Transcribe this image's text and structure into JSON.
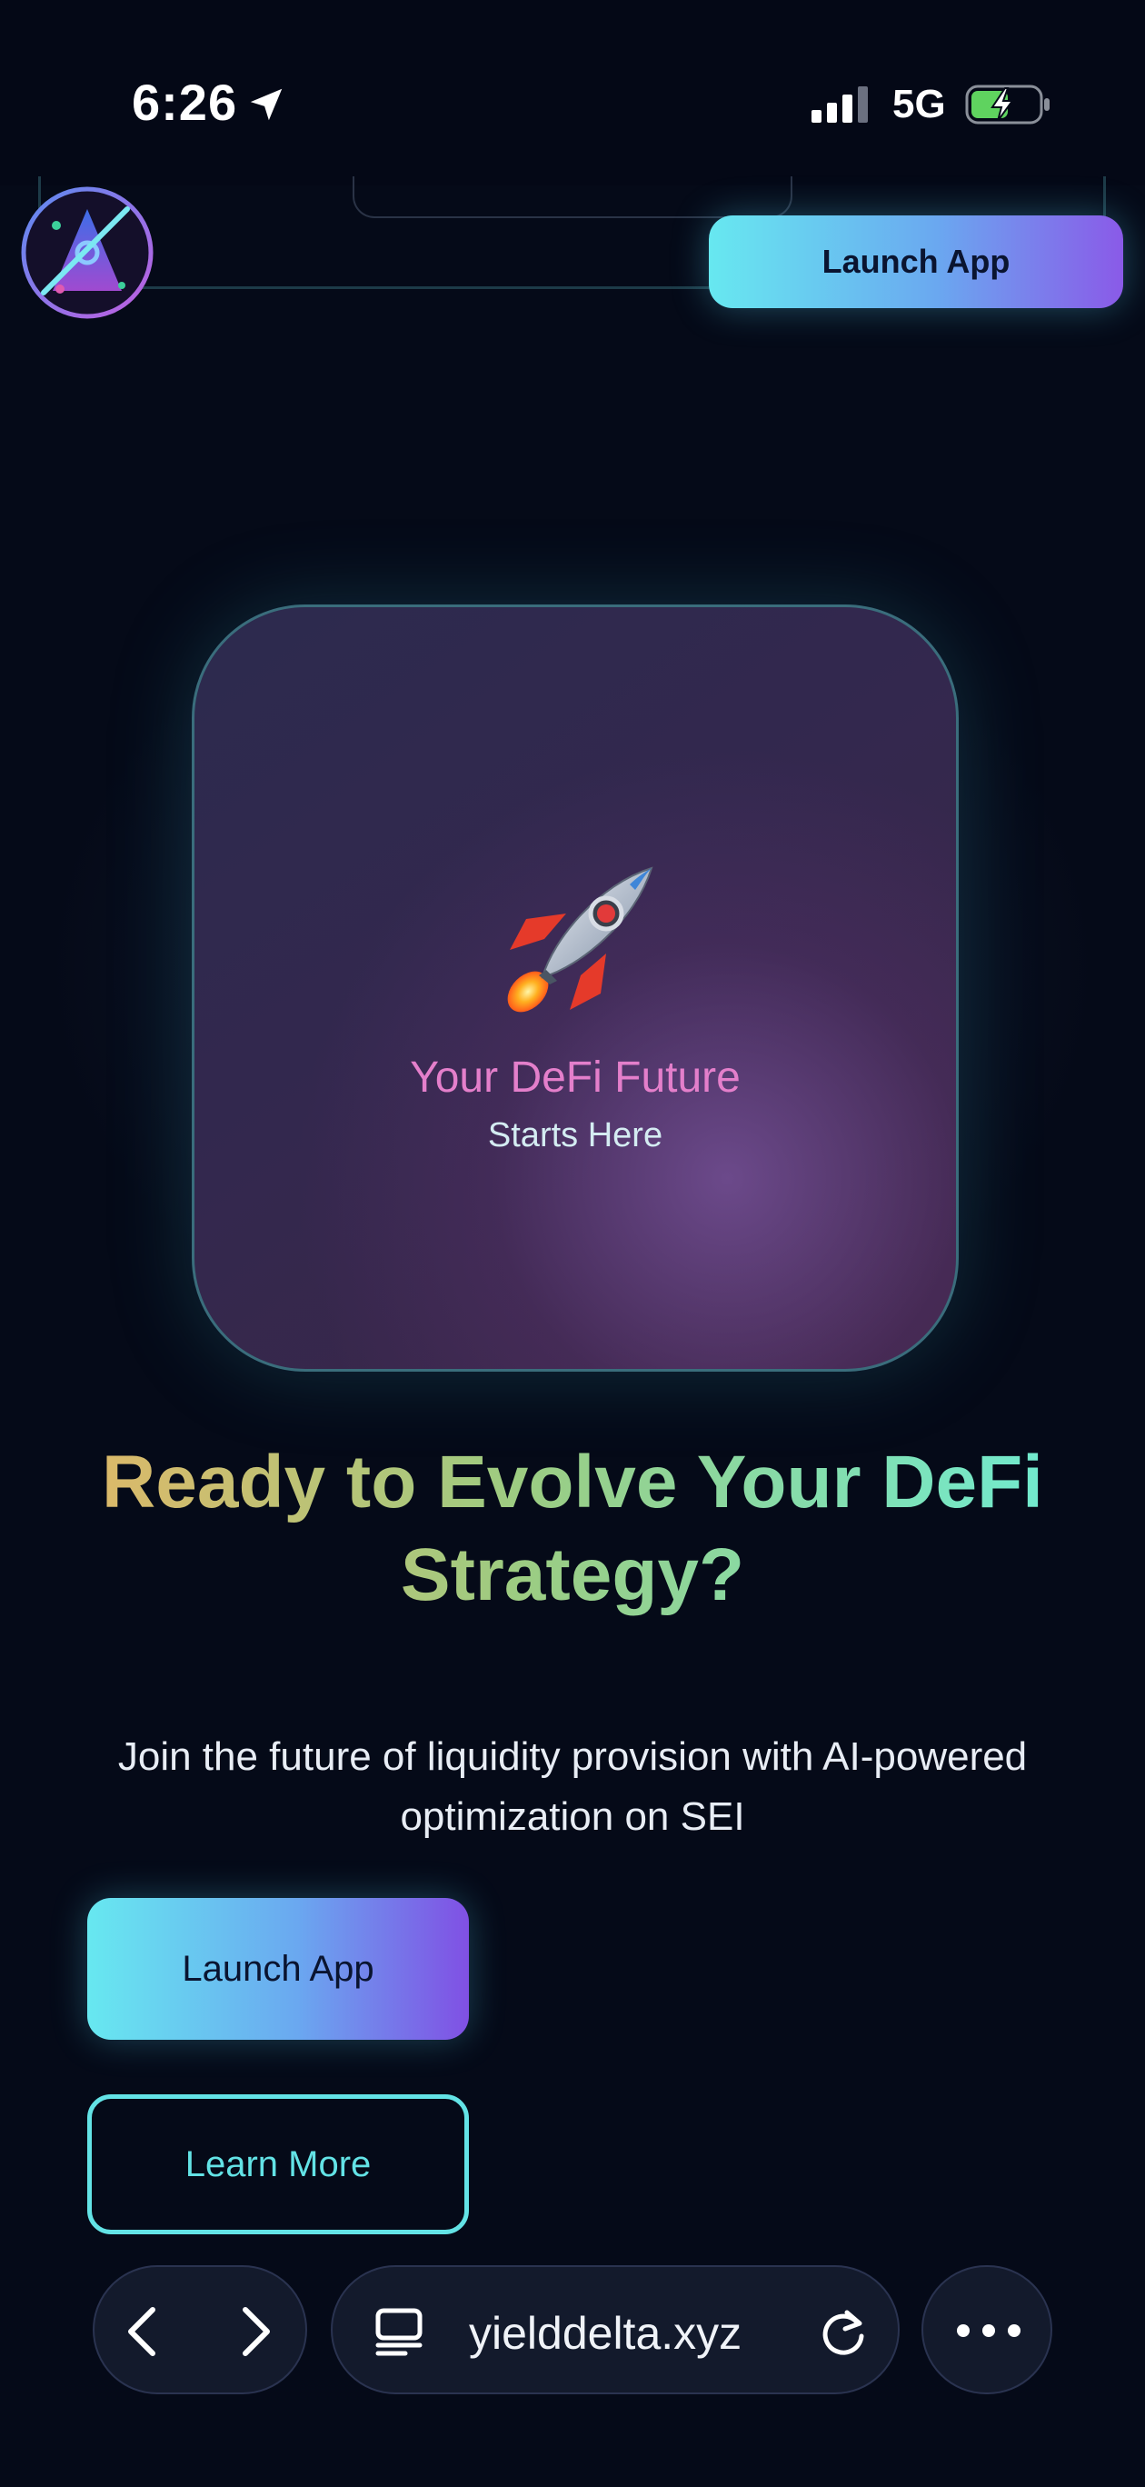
{
  "status_bar": {
    "time": "6:26",
    "network": "5G"
  },
  "header": {
    "launch_label": "Launch App"
  },
  "hero": {
    "emoji": "🚀",
    "title": "Your DeFi Future",
    "subtitle": "Starts Here"
  },
  "headline": "Ready to Evolve Your DeFi Strategy?",
  "description": "Join the future of liquidity provision with AI-powered optimization on SEI",
  "cta": {
    "launch_label": "Launch App",
    "learn_label": "Learn More"
  },
  "browser": {
    "url": "yielddelta.xyz"
  },
  "colors": {
    "background": "#050a18",
    "accent_cyan": "#63e3e6",
    "accent_purple": "#8a5ae8",
    "headline_gold": "#e2b767",
    "headline_teal": "#6eedd5",
    "hero_title_pink": "#e47fcb"
  },
  "icons": [
    "location-arrow-icon",
    "signal-icon",
    "battery-charging-icon",
    "logo-icon",
    "rocket-icon",
    "back-icon",
    "forward-icon",
    "tab-icon",
    "reload-icon",
    "more-icon"
  ]
}
